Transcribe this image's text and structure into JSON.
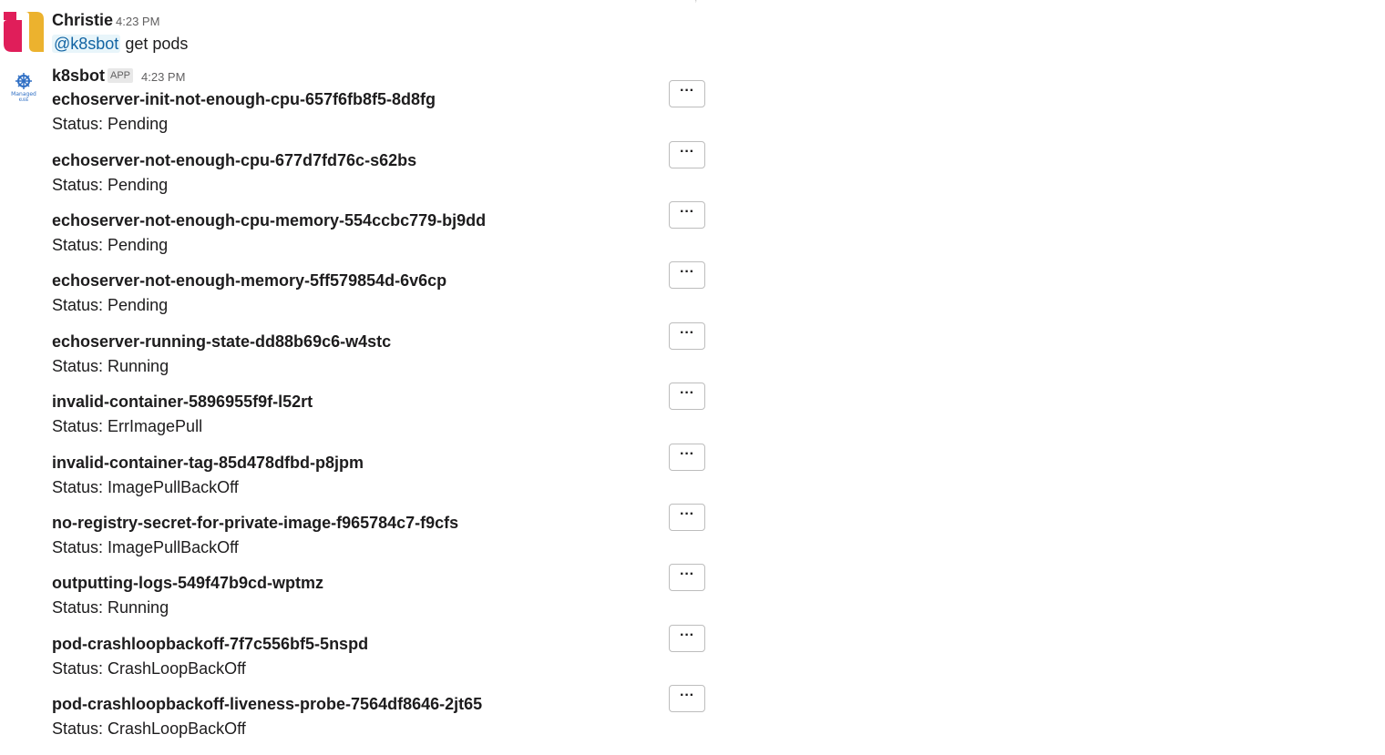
{
  "user_message": {
    "sender": "Christie",
    "time": "4:23 PM",
    "mention": "@k8sbot",
    "text": "get pods",
    "avatar_icon": "slack-logo-icon"
  },
  "bot_message": {
    "sender": "k8sbot",
    "badge": "APP",
    "time": "4:23 PM",
    "avatar_icon": "managed-kube-logo-icon",
    "pods": [
      {
        "name": "echoserver-init-not-enough-cpu-657f6fb8f5-8d8fg",
        "status": "Status: Pending"
      },
      {
        "name": "echoserver-not-enough-cpu-677d7fd76c-s62bs",
        "status": "Status: Pending"
      },
      {
        "name": "echoserver-not-enough-cpu-memory-554ccbc779-bj9dd",
        "status": "Status: Pending"
      },
      {
        "name": "echoserver-not-enough-memory-5ff579854d-6v6cp",
        "status": "Status: Pending"
      },
      {
        "name": "echoserver-running-state-dd88b69c6-w4stc",
        "status": "Status: Running"
      },
      {
        "name": "invalid-container-5896955f9f-l52rt",
        "status": "Status: ErrImagePull"
      },
      {
        "name": "invalid-container-tag-85d478dfbd-p8jpm",
        "status": "Status: ImagePullBackOff"
      },
      {
        "name": "no-registry-secret-for-private-image-f965784c7-f9cfs",
        "status": "Status: ImagePullBackOff"
      },
      {
        "name": "outputting-logs-549f47b9cd-wptmz",
        "status": "Status: Running"
      },
      {
        "name": "pod-crashloopbackoff-7f7c556bf5-5nspd",
        "status": "Status: CrashLoopBackOff"
      },
      {
        "name": "pod-crashloopbackoff-liveness-probe-7564df8646-2jt65",
        "status": "Status: CrashLoopBackOff"
      }
    ],
    "more_button_label": "···"
  }
}
